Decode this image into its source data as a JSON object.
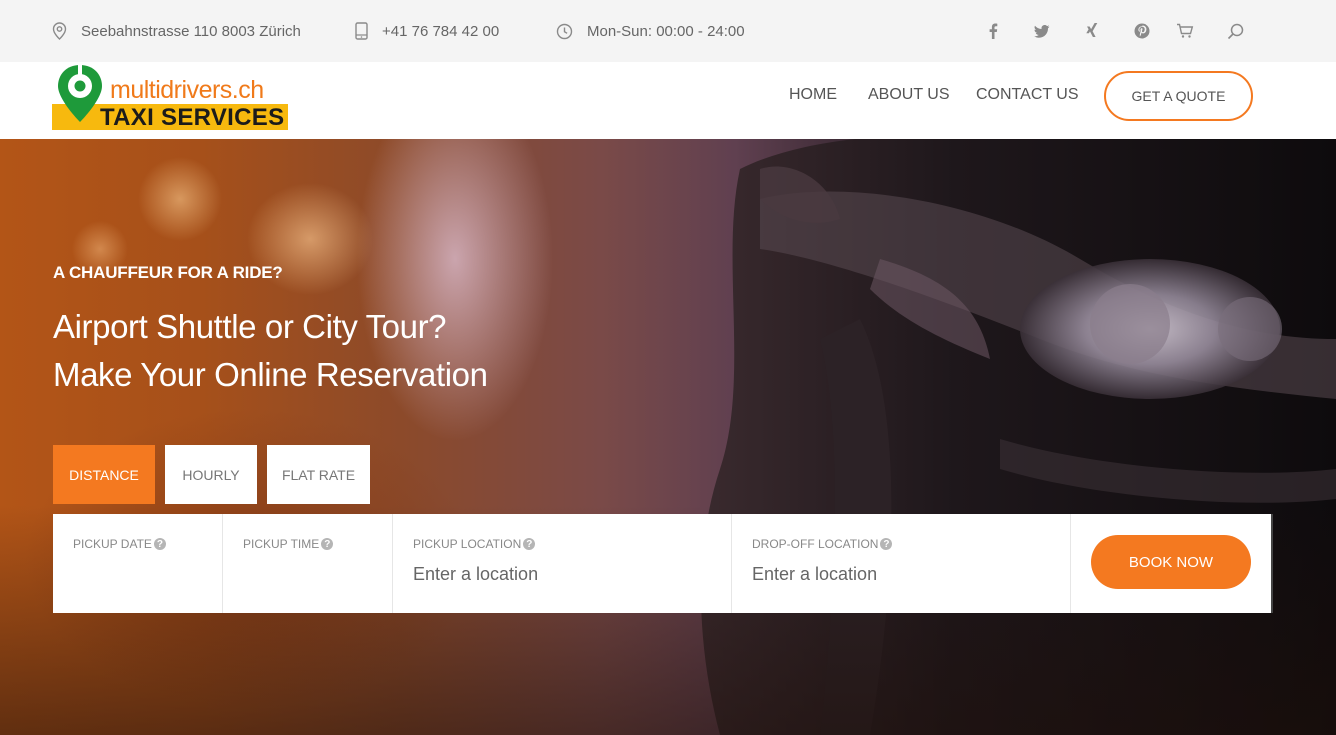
{
  "topbar": {
    "address": "Seebahnstrasse 110 8003 Zürich",
    "phone": "+41 76 784 42 00",
    "hours": "Mon-Sun: 00:00 - 24:00",
    "social_icons": [
      "facebook-icon",
      "twitter-icon",
      "xing-icon",
      "pinterest-icon",
      "cart-icon",
      "search-icon"
    ]
  },
  "logo": {
    "line1": "multidrivers.ch",
    "line2": "TAXI SERVICES"
  },
  "nav": {
    "items": [
      "HOME",
      "ABOUT US",
      "CONTACT US"
    ],
    "cta": "GET A QUOTE"
  },
  "hero": {
    "eyebrow": "A CHAUFFEUR FOR A RIDE?",
    "headline_line1": "Airport Shuttle or City Tour?",
    "headline_line2": "Make Your Online Reservation"
  },
  "tabs": [
    {
      "label": "DISTANCE",
      "active": true
    },
    {
      "label": "HOURLY",
      "active": false
    },
    {
      "label": "FLAT RATE",
      "active": false
    }
  ],
  "form": {
    "pickup_date_label": "PICKUP DATE",
    "pickup_time_label": "PICKUP TIME",
    "pickup_location_label": "PICKUP LOCATION",
    "pickup_location_placeholder": "Enter a location",
    "dropoff_location_label": "DROP-OFF LOCATION",
    "dropoff_location_placeholder": "Enter a location",
    "book_label": "BOOK NOW",
    "help_glyph": "?"
  },
  "colors": {
    "accent": "#f47920",
    "logo_yellow": "#f7b90e",
    "logo_green": "#1e9a3a"
  }
}
